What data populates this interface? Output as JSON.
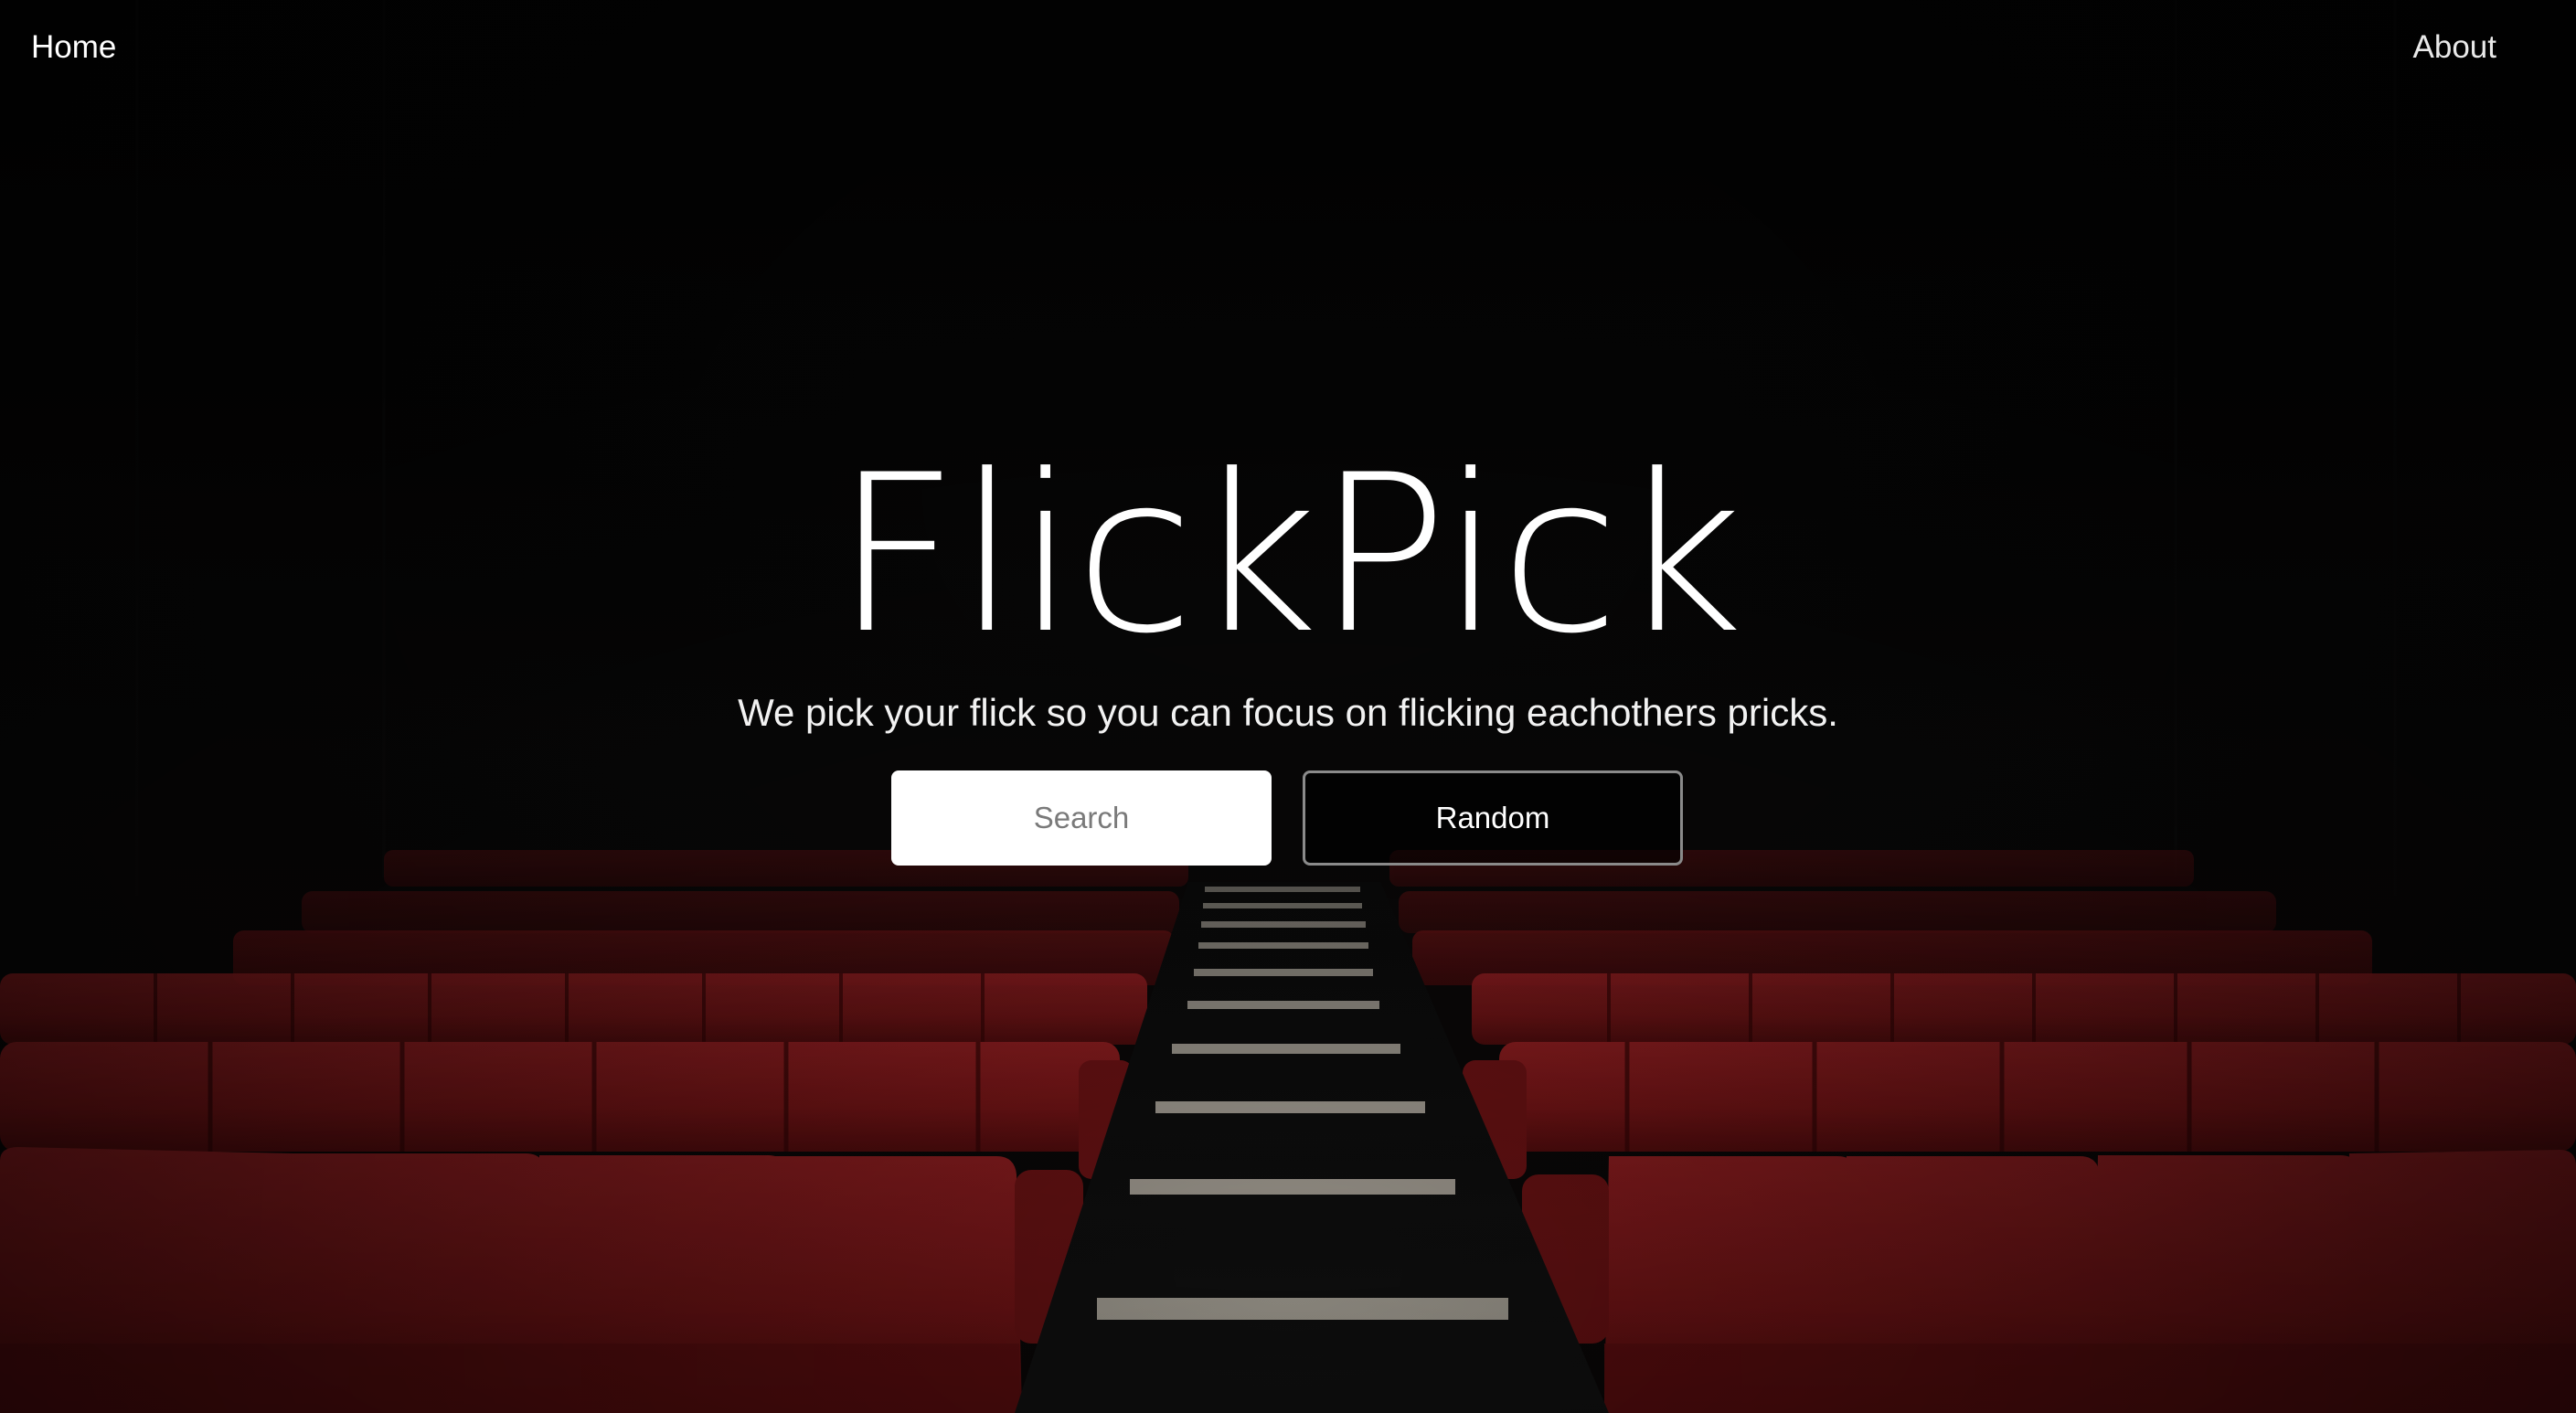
{
  "nav": {
    "home_label": "Home",
    "about_label": "About"
  },
  "hero": {
    "title": "FlickPick",
    "tagline": "We pick your flick so you can focus on flicking eachothers pricks."
  },
  "actions": {
    "search_placeholder": "Search",
    "random_label": "Random"
  },
  "colors": {
    "background": "#060606",
    "seat_red": "#8f1a1c",
    "seat_red_dark": "#5a0c0e",
    "text": "#ffffff",
    "button_border": "#8a8a8a"
  }
}
